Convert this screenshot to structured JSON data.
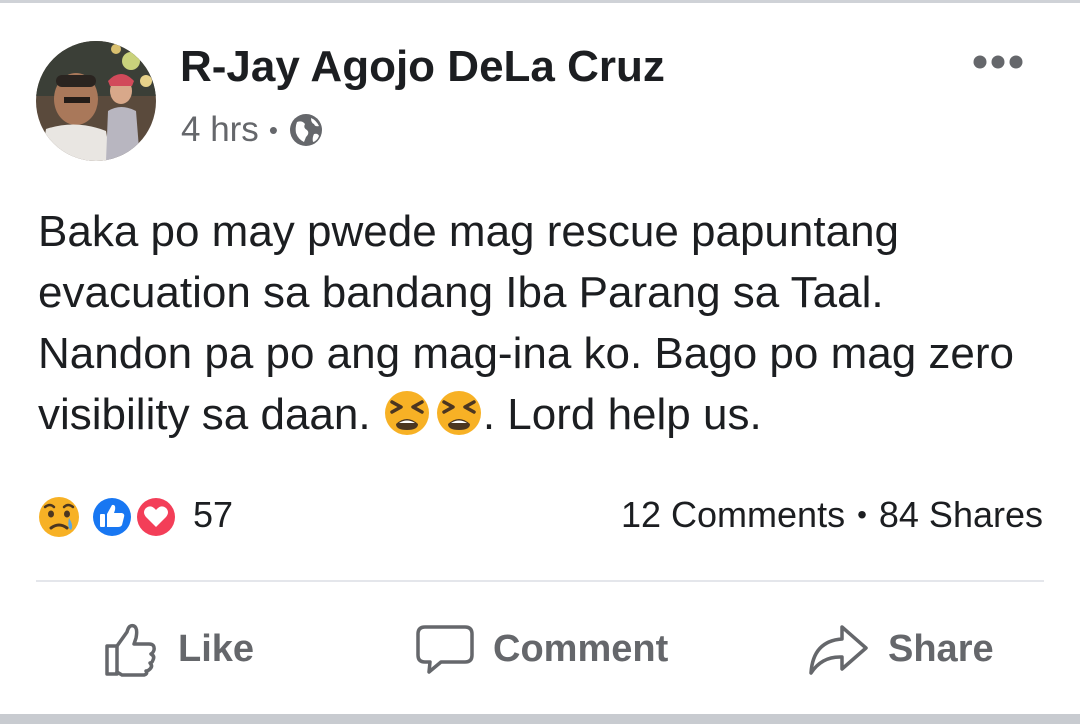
{
  "post": {
    "author": "R-Jay Agojo DeLa Cruz",
    "time": "4 hrs",
    "separator": "•",
    "privacy_icon": "globe-icon",
    "text_before_emoji": "Baka po may pwede mag rescue papuntang evacuation sa bandang Iba Parang sa Taal. Nandon pa po ang mag-ina ko. Bago po mag zero visibility sa daan. ",
    "emojis": [
      "tired-face-emoji",
      "tired-face-emoji"
    ],
    "text_after_emoji": ". Lord help us."
  },
  "reactions": {
    "icons": [
      "sad-reaction-icon",
      "like-reaction-icon",
      "love-reaction-icon"
    ],
    "count": "57"
  },
  "stats": {
    "comments": "12 Comments",
    "separator": "•",
    "shares": "84 Shares"
  },
  "actions": {
    "like": "Like",
    "comment": "Comment",
    "share": "Share"
  },
  "colors": {
    "text": "#1c1e21",
    "secondary": "#65676b",
    "like_blue": "#1877f2",
    "love_red": "#f33e58",
    "emoji_yellow": "#f7b125"
  }
}
